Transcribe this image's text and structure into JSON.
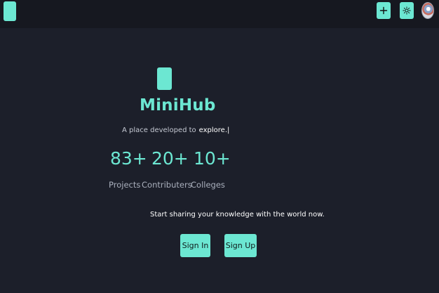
{
  "app": {
    "title": "MiniHub",
    "tagline_prefix": "A place developed to",
    "tagline_typed": "explore.|"
  },
  "stats": [
    {
      "value": "83+",
      "label": "Projects"
    },
    {
      "value": "20+",
      "label": "Contributers"
    },
    {
      "value": "10+",
      "label": "Colleges"
    }
  ],
  "cta": {
    "text": "Start sharing your knowledge with the world now.",
    "sign_in": "Sign In",
    "sign_up": "Sign Up"
  },
  "colors": {
    "accent": "#6ce7d2",
    "background": "#1c1f2a",
    "topbar": "#161820"
  },
  "icons": {
    "add": "plus-icon",
    "theme": "theme-toggle-icon"
  }
}
